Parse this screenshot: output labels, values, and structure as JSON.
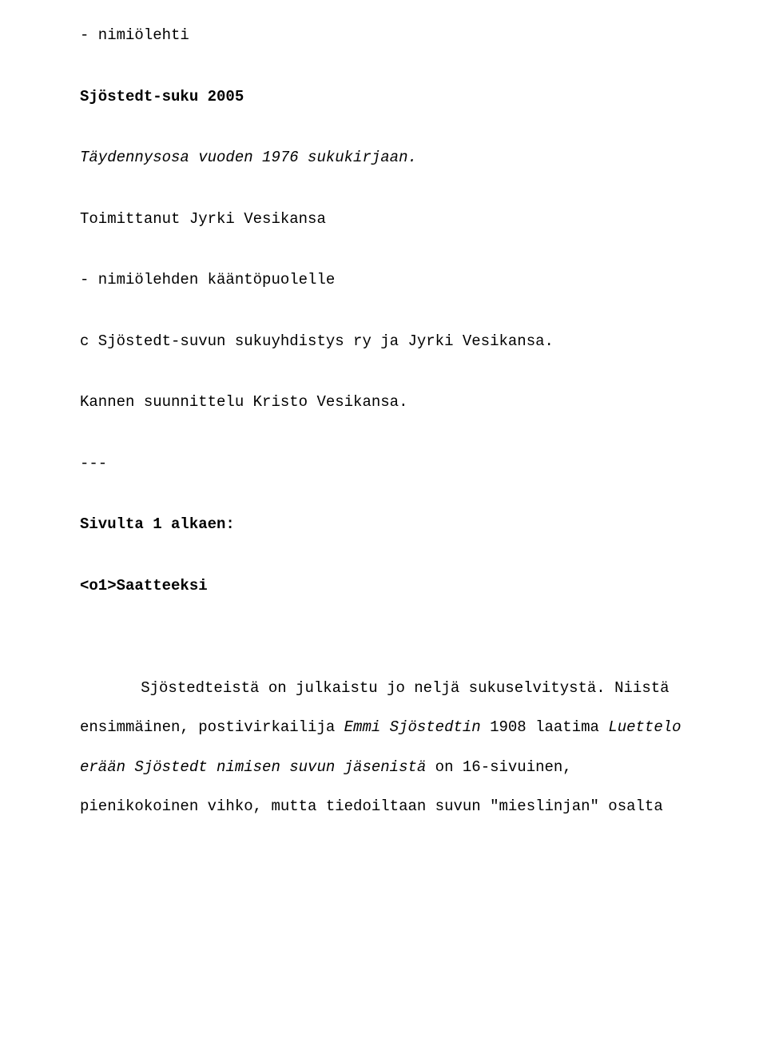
{
  "l1": "- nimiölehti",
  "l2": "Sjöstedt-suku 2005",
  "l3": "Täydennysosa vuoden 1976 sukukirjaan.",
  "l4": "Toimittanut Jyrki Vesikansa",
  "l5": "- nimiölehden kääntöpuolelle",
  "l6": "c Sjöstedt-suvun sukuyhdistys ry ja Jyrki Vesikansa.",
  "l7": "Kannen suunnittelu Kristo Vesikansa.",
  "dashes": "---",
  "l8": "Sivulta 1 alkaen:",
  "l9": "<o1>Saatteeksi",
  "p_lead": "Sjöstedteistä on julkaistu jo neljä sukuselvitystä. Niistä ",
  "p_r1a": "ensimmäinen, postivirkailija ",
  "p_r1b": "Emmi Sjöstedtin",
  "p_r1c": " 1908 laatima ",
  "p_r2a": "Luettelo erään Sjöstedt nimisen suvun jäsenistä",
  "p_r2b": " on 16-sivuinen, ",
  "p_r3": "pienikokoinen vihko, mutta tiedoiltaan suvun \"mieslinjan\" osalta"
}
